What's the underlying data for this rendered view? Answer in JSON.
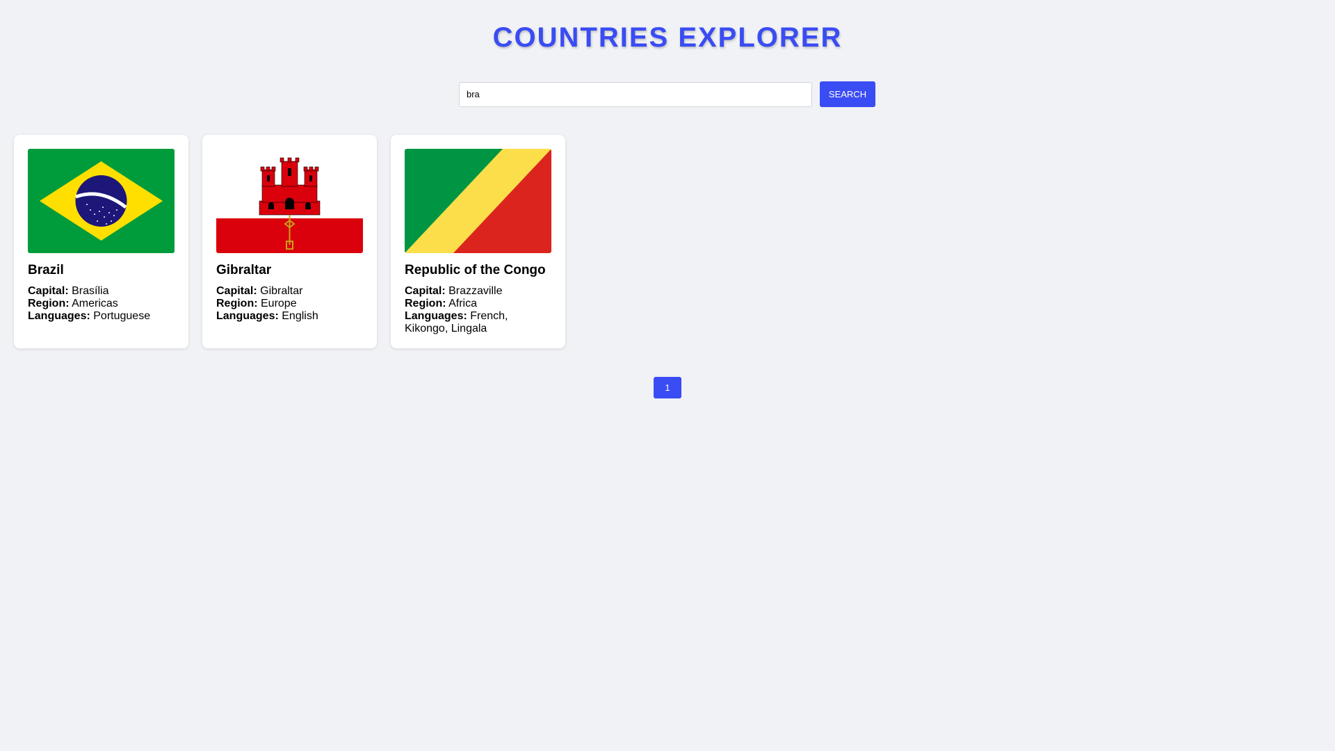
{
  "header": {
    "title": "COUNTRIES EXPLORER"
  },
  "search": {
    "value": "bra",
    "button_label": "SEARCH"
  },
  "labels": {
    "capital": "Capital:",
    "region": "Region:",
    "languages": "Languages:"
  },
  "countries": [
    {
      "name": "Brazil",
      "capital": "Brasília",
      "region": "Americas",
      "languages": "Portuguese",
      "flag": "brazil-flag"
    },
    {
      "name": "Gibraltar",
      "capital": "Gibraltar",
      "region": "Europe",
      "languages": "English",
      "flag": "gibraltar-flag"
    },
    {
      "name": "Republic of the Congo",
      "capital": "Brazzaville",
      "region": "Africa",
      "languages": "French, Kikongo, Lingala",
      "flag": "congo-flag"
    }
  ],
  "pagination": {
    "pages": [
      "1"
    ],
    "current": "1"
  },
  "colors": {
    "accent": "#3a4cf3",
    "background": "#f0f2f5",
    "card": "#ffffff"
  }
}
